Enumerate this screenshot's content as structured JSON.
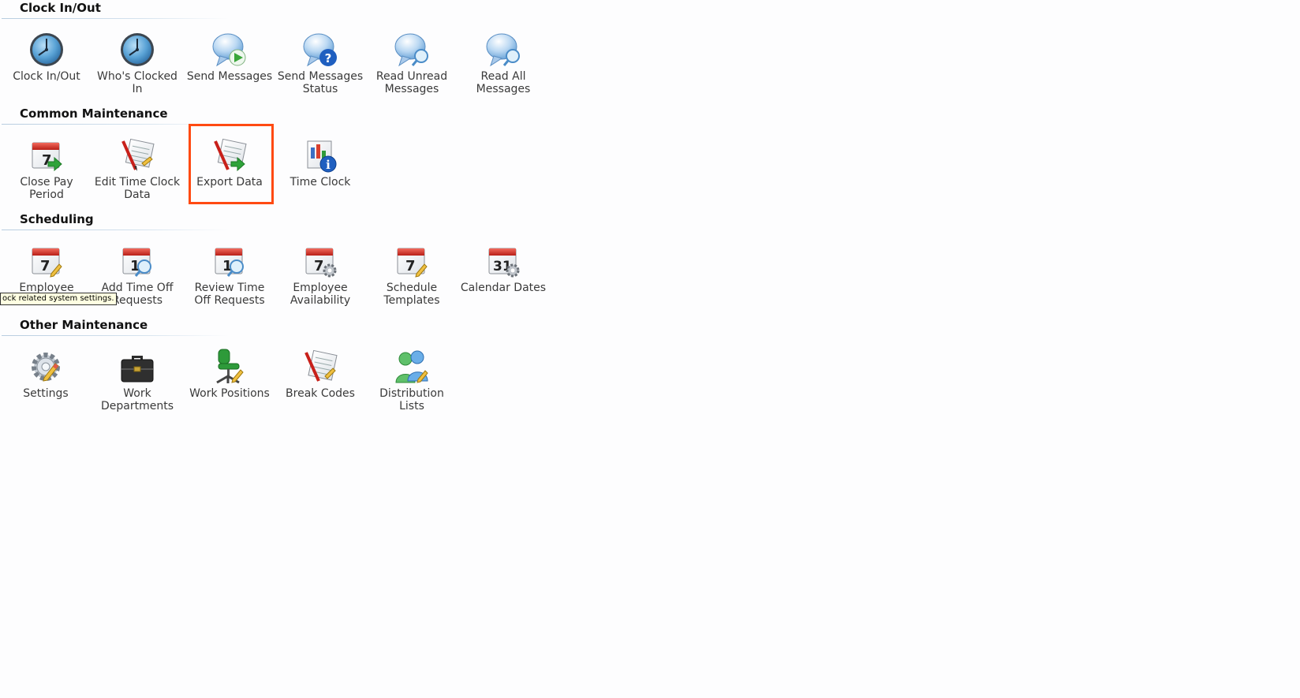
{
  "sections": [
    {
      "title": "Clock In/Out",
      "items": [
        {
          "label": "Clock In/Out",
          "icon": "clock-icon"
        },
        {
          "label": "Who's Clocked In",
          "icon": "clock-icon"
        },
        {
          "label": "Send Messages",
          "icon": "message-send-icon"
        },
        {
          "label": "Send Messages Status",
          "icon": "message-status-icon"
        },
        {
          "label": "Read Unread Messages",
          "icon": "message-search-icon"
        },
        {
          "label": "Read All Messages",
          "icon": "message-search-icon"
        }
      ]
    },
    {
      "title": "Common Maintenance",
      "items": [
        {
          "label": "Close Pay Period",
          "icon": "calendar-arrow-icon"
        },
        {
          "label": "Edit Time Clock Data",
          "icon": "timesheet-pencil-icon"
        },
        {
          "label": "Export Data",
          "icon": "timesheet-export-icon"
        },
        {
          "label": "Time Clock",
          "icon": "report-info-icon"
        }
      ]
    },
    {
      "title": "Scheduling",
      "items": [
        {
          "label": "Employee",
          "icon": "calendar-pencil-icon"
        },
        {
          "label": "Add Time Off Requests",
          "icon": "calendar-search-icon"
        },
        {
          "label": "Review Time Off Requests",
          "icon": "calendar-search-icon"
        },
        {
          "label": "Employee Availability",
          "icon": "calendar-gear-icon"
        },
        {
          "label": "Schedule Templates",
          "icon": "calendar-pencil-icon"
        },
        {
          "label": "Calendar Dates",
          "icon": "calendar-gear-icon"
        }
      ]
    },
    {
      "title": "Other Maintenance",
      "items": [
        {
          "label": "Settings",
          "icon": "gear-icon"
        },
        {
          "label": "Work Departments",
          "icon": "briefcase-icon"
        },
        {
          "label": "Work Positions",
          "icon": "chair-icon"
        },
        {
          "label": "Break Codes",
          "icon": "document-pencil-icon"
        },
        {
          "label": "Distribution Lists",
          "icon": "users-icon"
        }
      ]
    }
  ],
  "tooltip": "ock related system settings.",
  "calendar_numbers": {
    "seven": "7",
    "one": "1",
    "thirtyone": "31"
  },
  "colors": {
    "highlight": "#ff4a12",
    "section_rule": "#b8cde0",
    "label_text": "#3a3a3a"
  }
}
